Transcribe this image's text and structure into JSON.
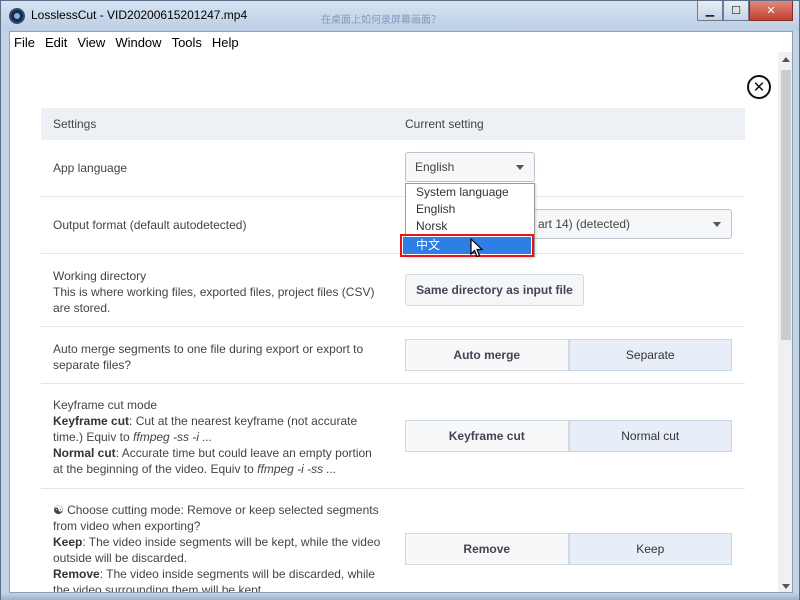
{
  "window": {
    "title": "LosslessCut - VID20200615201247.mp4",
    "background_title": "在桌面上如何录屏幕画面？"
  },
  "menubar": {
    "items": [
      "File",
      "Edit",
      "View",
      "Window",
      "Tools",
      "Help"
    ]
  },
  "settings": {
    "header_settings": "Settings",
    "header_current": "Current setting",
    "app_language": {
      "label": "App language",
      "value": "English",
      "dropdown_options": [
        "System language",
        "English",
        "Norsk",
        "中文"
      ],
      "highlighted_option": "中文"
    },
    "output_format": {
      "label": "Output format (default autodetected)",
      "value_visible_fragment": "art 14) (detected)"
    },
    "working_dir": {
      "label_title": "Working directory",
      "label_desc": "This is where working files, exported files, project files (CSV) are stored.",
      "button": "Same directory as input file"
    },
    "auto_merge": {
      "label": "Auto merge segments to one file during export or export to separate files?",
      "option_a": "Auto merge",
      "option_b": "Separate",
      "active": "Separate"
    },
    "keyframe": {
      "title": "Keyframe cut mode",
      "kf_bold": "Keyframe cut",
      "kf_text": ": Cut at the nearest keyframe (not accurate time.) Equiv to ",
      "kf_cmd": "ffmpeg -ss -i ...",
      "normal_bold": "Normal cut",
      "normal_text": ": Accurate time but could leave an empty portion at the beginning of the video. Equiv to ",
      "normal_cmd": "ffmpeg -i -ss ...",
      "option_a": "Keyframe cut",
      "option_b": "Normal cut",
      "active": "Normal cut"
    },
    "cutting_mode": {
      "title": "☯ Choose cutting mode: Remove or keep selected segments from video when exporting?",
      "keep_bold": "Keep",
      "keep_text": ": The video inside segments will be kept, while the video outside will be discarded.",
      "remove_bold": "Remove",
      "remove_text": ": The video inside segments will be discarded, while the video surrounding them will be kept.",
      "option_a": "Remove",
      "option_b": "Keep",
      "active": "Keep"
    }
  },
  "colors": {
    "selection_blue": "#2e7ee6",
    "highlight_red": "#e4141a",
    "active_segment": "#e7eef8"
  }
}
